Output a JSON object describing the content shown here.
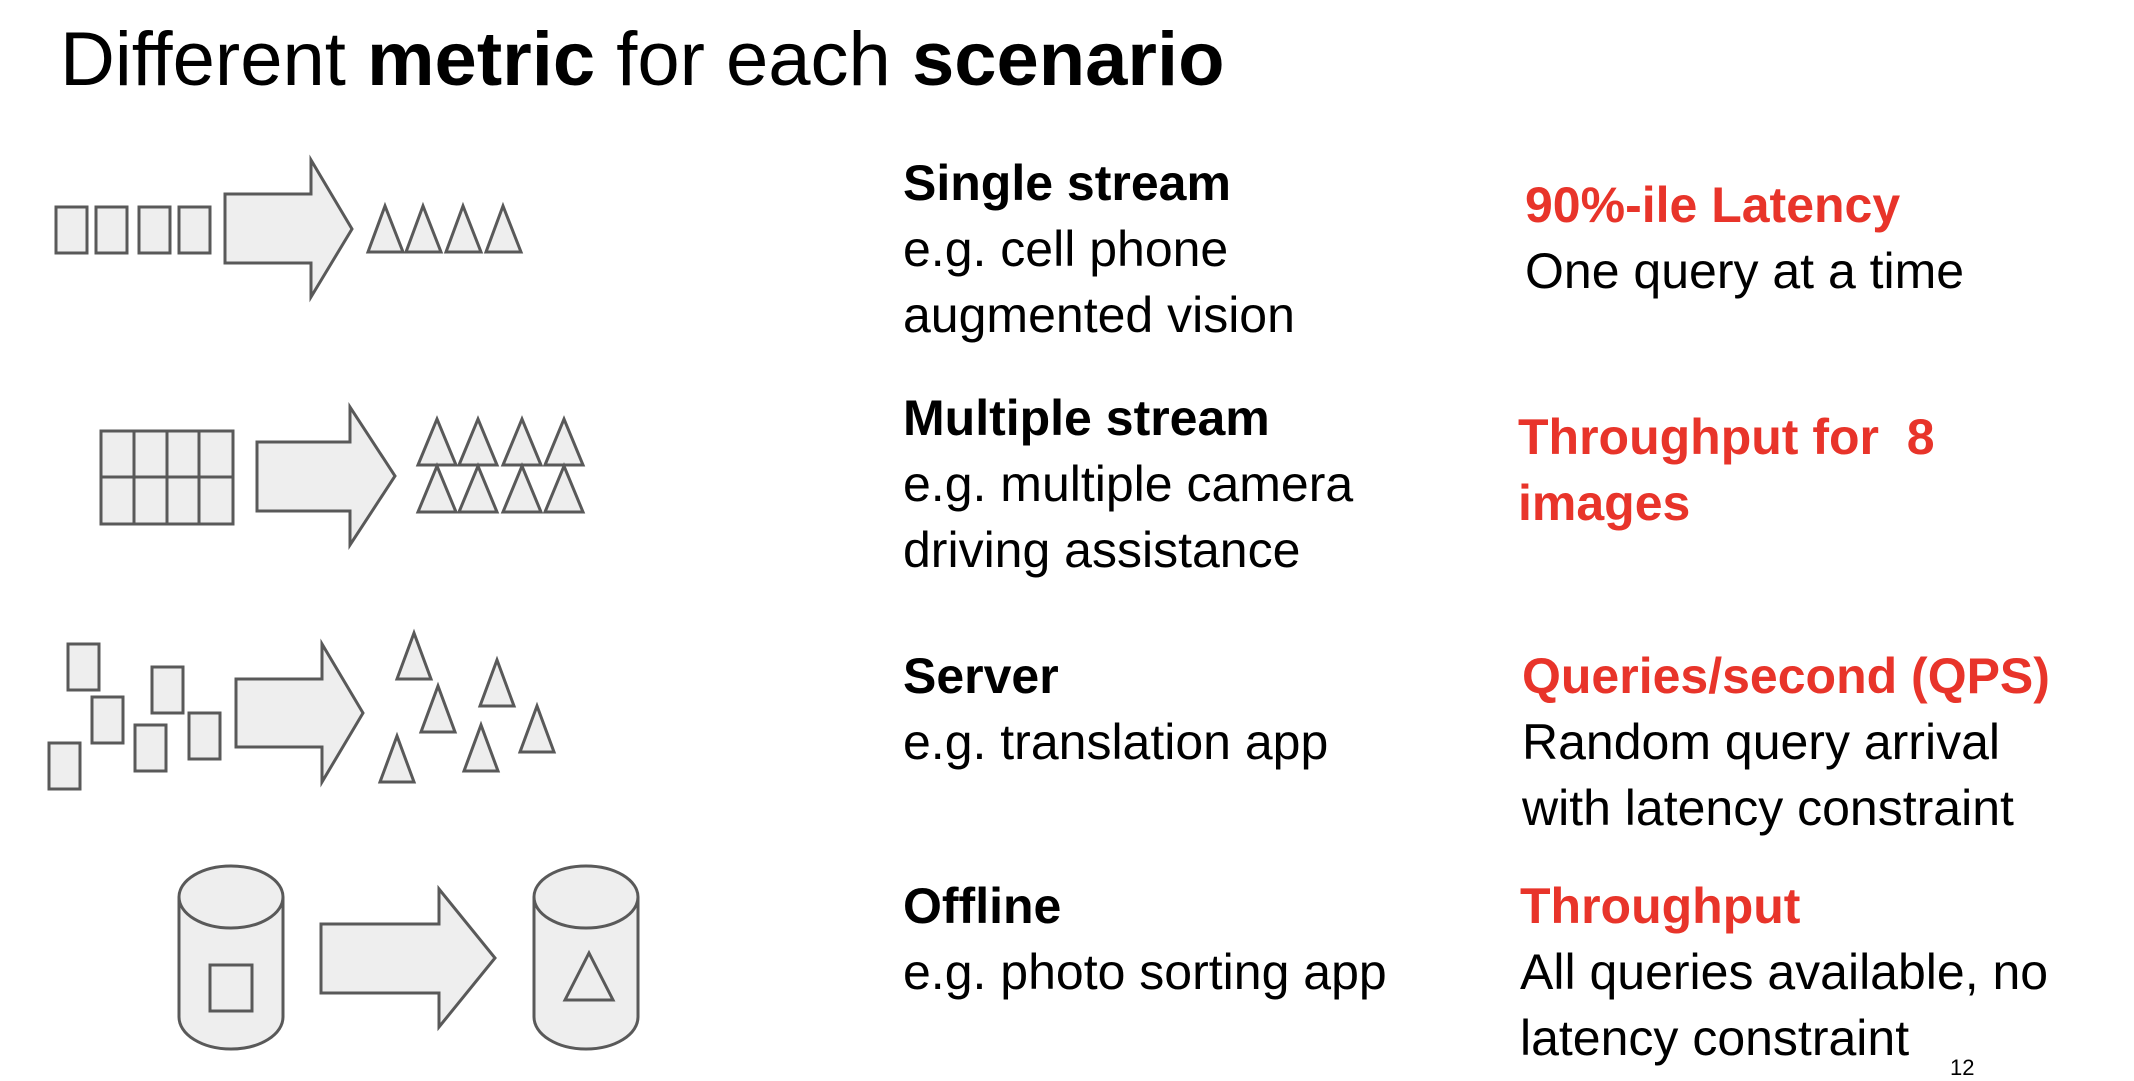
{
  "slide": {
    "title_parts": [
      {
        "text": "Different ",
        "bold": false
      },
      {
        "text": "metric",
        "bold": true
      },
      {
        "text": " for each ",
        "bold": false
      },
      {
        "text": "scenario",
        "bold": true
      }
    ],
    "page_number": "12"
  },
  "colors": {
    "accent": "#e8342a",
    "shape_fill": "#eeeeee",
    "shape_stroke": "#595959",
    "text": "#000000"
  },
  "scenarios": [
    {
      "name": "Single stream",
      "example_lines": [
        "e.g. cell phone",
        "augmented vision"
      ],
      "metric": "90%-ile Latency",
      "metric_detail_lines": [
        "One query at a time"
      ],
      "input_icon": "square-icon x4 in a row",
      "output_icon": "triangle-icon x4 in a row"
    },
    {
      "name": "Multiple stream",
      "example_lines": [
        "e.g. multiple camera",
        "driving assistance"
      ],
      "metric_lines": [
        "Throughput for  8",
        "images"
      ],
      "metric_detail_lines": [],
      "input_icon": "grid-icon 2x4",
      "output_icon": "triangle-icon 2x4 grid"
    },
    {
      "name": "Server",
      "example_lines": [
        "e.g. translation app"
      ],
      "metric": "Queries/second (QPS)",
      "metric_detail_lines": [
        "Random query arrival",
        "with latency constraint"
      ],
      "input_icon": "square-icon scattered x6",
      "output_icon": "triangle-icon scattered x7"
    },
    {
      "name": "Offline",
      "example_lines": [
        "e.g. photo sorting app"
      ],
      "metric": "Throughput",
      "metric_detail_lines": [
        "All queries available, no",
        "latency constraint"
      ],
      "input_icon": "database-cylinder-icon with square",
      "output_icon": "database-cylinder-icon with triangle"
    }
  ]
}
